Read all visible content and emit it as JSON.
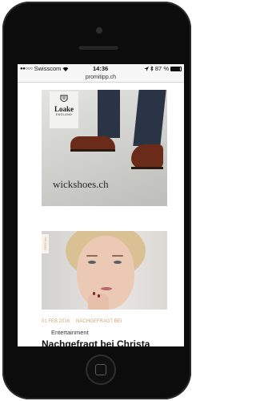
{
  "status_bar": {
    "signal": "●●○○○",
    "carrier": "Swisscom",
    "time": "14:36",
    "battery": "87 %"
  },
  "browser": {
    "url": "promitipp.ch"
  },
  "ad": {
    "brand": "Loake",
    "brand_sub": "ENGLAND",
    "domain": "wickshoes.ch"
  },
  "article": {
    "side_tab": "SPECIAL",
    "date": "01 FEB 2016",
    "tag": "NACHGEFRAGT BEI",
    "category": "Entertainment",
    "title": "Nachgefragt bei Christa"
  }
}
